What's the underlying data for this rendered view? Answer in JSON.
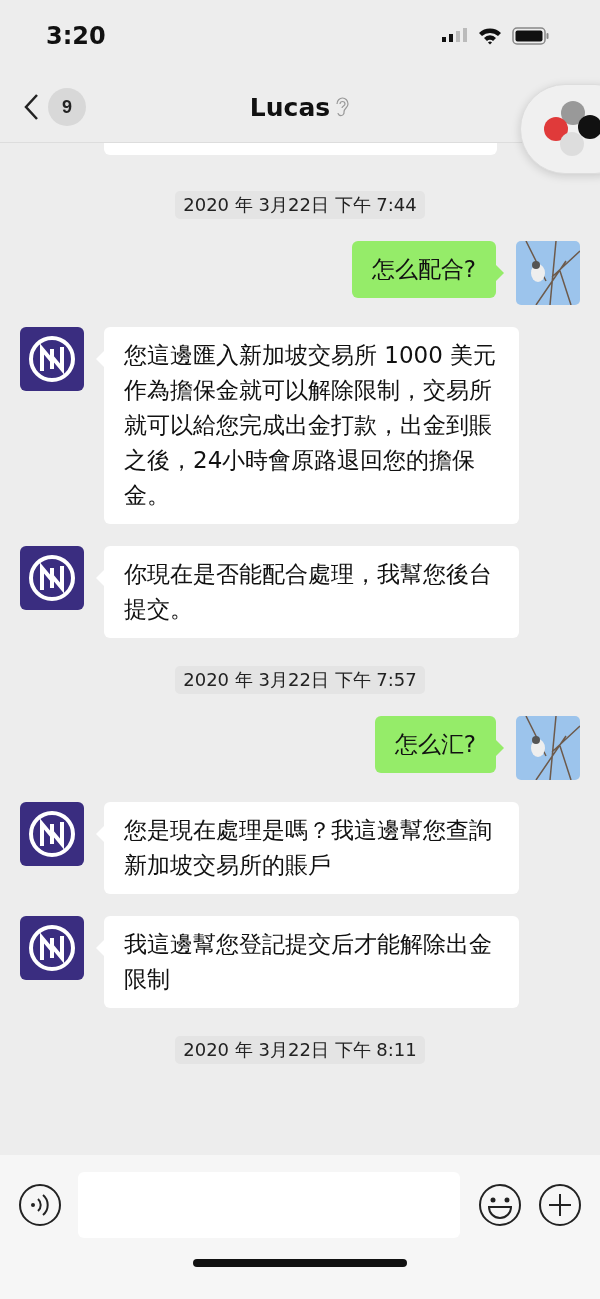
{
  "status_bar": {
    "time": "3:20"
  },
  "nav": {
    "back_count": "9",
    "title": "Lucas"
  },
  "messages": [
    {
      "kind": "timestamp",
      "text": "2020 年 3月22日 下午 7:44"
    },
    {
      "kind": "sent",
      "text": "怎么配合?"
    },
    {
      "kind": "received",
      "text": "您這邊匯入新加坡交易所 1000 美元作為擔保金就可以解除限制，交易所就可以給您完成出金打款，出金到賬之後，24小時會原路退回您的擔保金。"
    },
    {
      "kind": "received",
      "text": "你現在是否能配合處理，我幫您後台提交。"
    },
    {
      "kind": "timestamp",
      "text": "2020 年 3月22日 下午 7:57"
    },
    {
      "kind": "sent",
      "text": "怎么汇?"
    },
    {
      "kind": "received",
      "text": "您是現在處理是嗎？我這邊幫您查詢新加坡交易所的賬戶"
    },
    {
      "kind": "received",
      "text": "我這邊幫您登記提交后才能解除出金限制"
    },
    {
      "kind": "timestamp",
      "text": "2020 年 3月22日 下午 8:11"
    }
  ]
}
